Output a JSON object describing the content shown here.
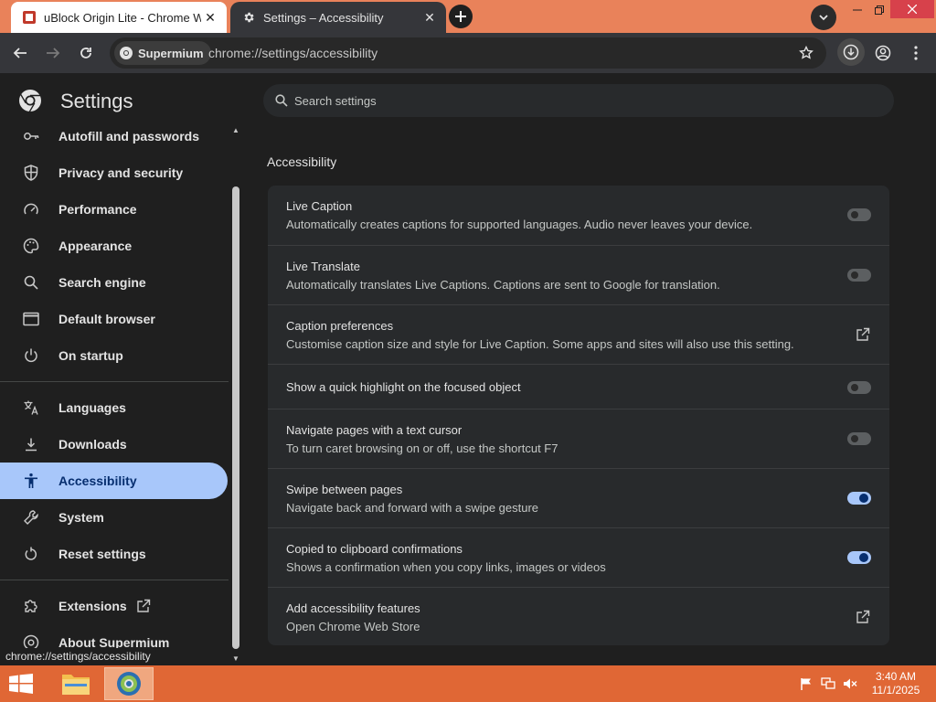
{
  "tabs": [
    {
      "title": "uBlock Origin Lite - Chrome We",
      "active": false
    },
    {
      "title": "Settings – Accessibility",
      "active": true
    }
  ],
  "toolbar": {
    "chip_label": "Supermium",
    "url": "chrome://settings/accessibility"
  },
  "header": {
    "title": "Settings",
    "search_placeholder": "Search settings"
  },
  "sidebar": {
    "items": [
      {
        "label": "Autofill and passwords",
        "icon": "key-icon"
      },
      {
        "label": "Privacy and security",
        "icon": "shield-icon"
      },
      {
        "label": "Performance",
        "icon": "speedometer-icon"
      },
      {
        "label": "Appearance",
        "icon": "palette-icon"
      },
      {
        "label": "Search engine",
        "icon": "search-icon"
      },
      {
        "label": "Default browser",
        "icon": "browser-window-icon"
      },
      {
        "label": "On startup",
        "icon": "power-icon"
      },
      {
        "label": "Languages",
        "icon": "translate-icon"
      },
      {
        "label": "Downloads",
        "icon": "download-icon"
      },
      {
        "label": "Accessibility",
        "icon": "accessibility-icon",
        "active": true
      },
      {
        "label": "System",
        "icon": "wrench-icon"
      },
      {
        "label": "Reset settings",
        "icon": "reset-icon"
      },
      {
        "label": "Extensions",
        "icon": "puzzle-icon"
      },
      {
        "label": "About Supermium",
        "icon": "chromium-logo-icon"
      }
    ]
  },
  "main": {
    "section_title": "Accessibility",
    "rows": [
      {
        "title": "Live Caption",
        "subtitle": "Automatically creates captions for supported languages. Audio never leaves your device.",
        "control": "toggle",
        "on": false
      },
      {
        "title": "Live Translate",
        "subtitle": "Automatically translates Live Captions. Captions are sent to Google for translation.",
        "control": "toggle",
        "on": false
      },
      {
        "title": "Caption preferences",
        "subtitle": "Customise caption size and style for Live Caption. Some apps and sites will also use this setting.",
        "control": "external-link"
      },
      {
        "title": "Show a quick highlight on the focused object",
        "subtitle": "",
        "control": "toggle",
        "on": false
      },
      {
        "title": "Navigate pages with a text cursor",
        "subtitle": "To turn caret browsing on or off, use the shortcut F7",
        "control": "toggle",
        "on": false
      },
      {
        "title": "Swipe between pages",
        "subtitle": "Navigate back and forward with a swipe gesture",
        "control": "toggle",
        "on": true
      },
      {
        "title": "Copied to clipboard confirmations",
        "subtitle": "Shows a confirmation when you copy links, images or videos",
        "control": "toggle",
        "on": true
      },
      {
        "title": "Add accessibility features",
        "subtitle": "Open Chrome Web Store",
        "control": "external-link"
      }
    ]
  },
  "status_url": "chrome://settings/accessibility",
  "taskbar": {
    "time": "3:40 AM",
    "date": "11/1/2025"
  },
  "colors": {
    "accent": "#a8c7fa",
    "tabstrip": "#e9825a",
    "taskbar": "#e06735",
    "close_button": "#d7414b"
  }
}
